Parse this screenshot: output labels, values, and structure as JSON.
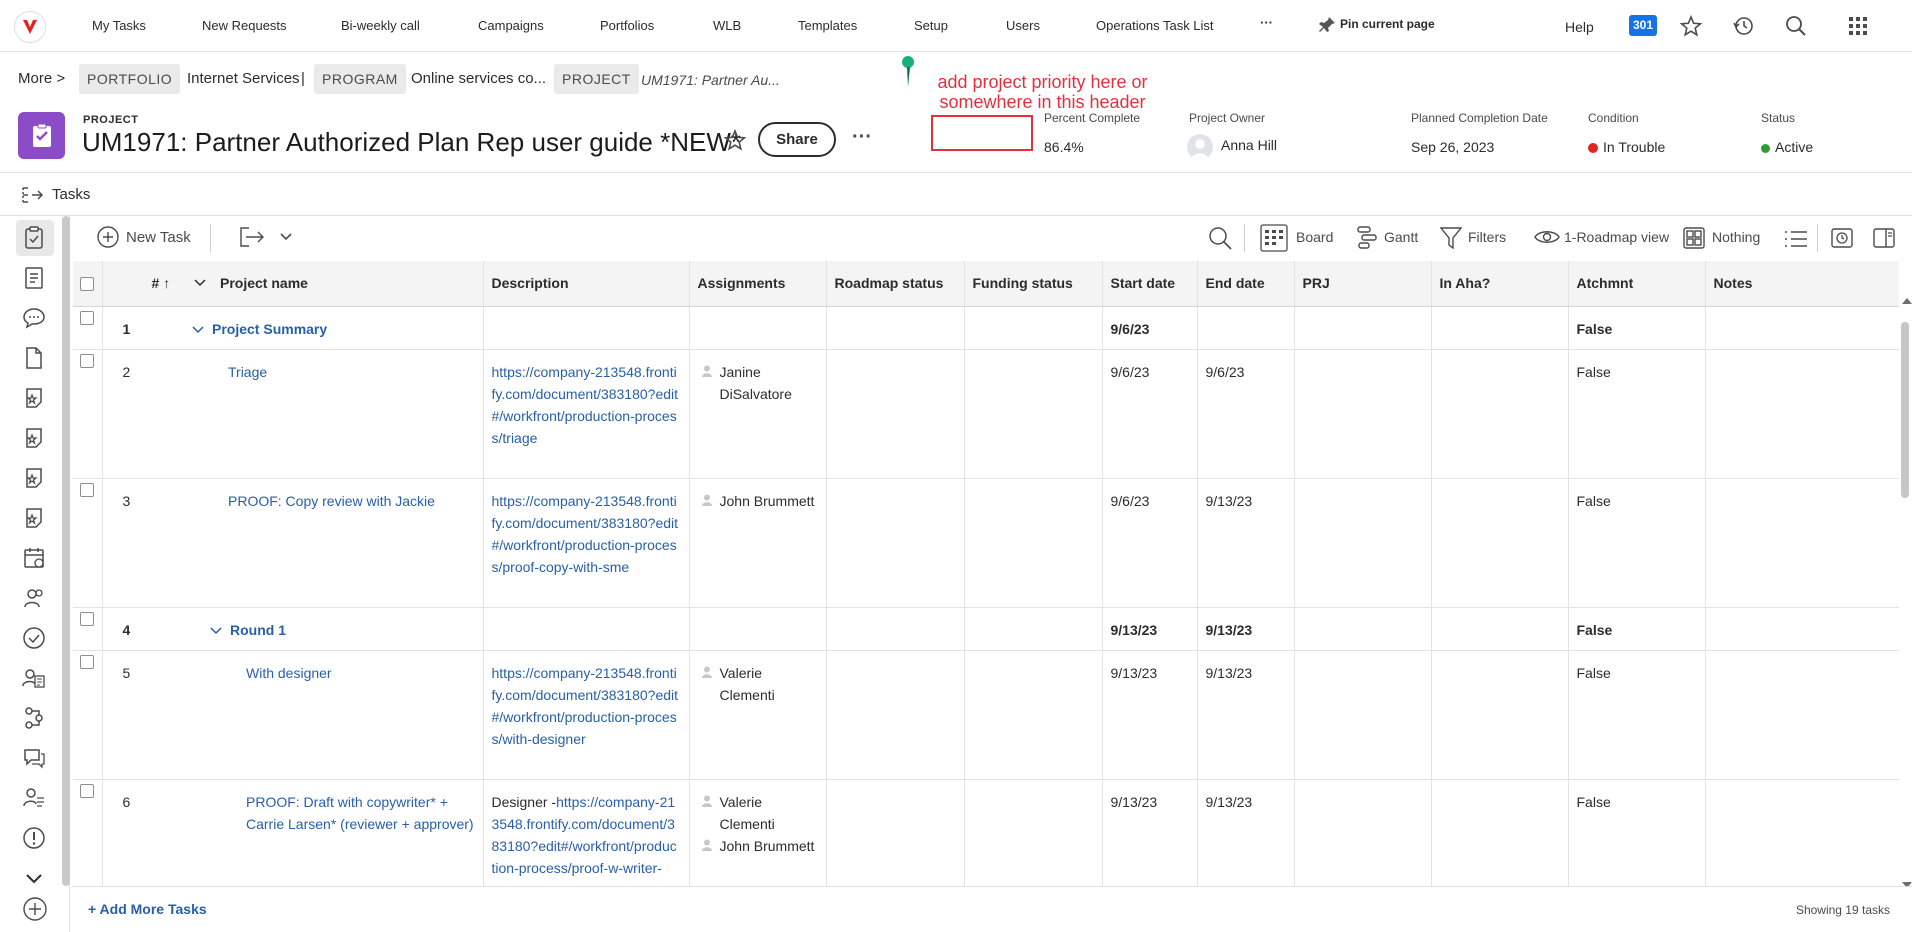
{
  "nav": {
    "items": [
      "My Tasks",
      "New Requests",
      "Bi-weekly call",
      "Campaigns",
      "Portfolios",
      "WLB",
      "Templates",
      "Setup",
      "Users",
      "Operations Task List"
    ],
    "more": "···",
    "pin": "Pin current page",
    "help": "Help",
    "badge": "301"
  },
  "breadcrumb": {
    "more": "More >",
    "portfolio_tag": "PORTFOLIO",
    "portfolio": "Internet Services",
    "sep": "|",
    "program_tag": "PROGRAM",
    "program": "Online services co...",
    "project_tag": "PROJECT",
    "project": "UM1971: Partner Au..."
  },
  "header": {
    "label": "PROJECT",
    "title": "UM1971: Partner Authorized Plan Rep user guide *NEW*",
    "share": "Share",
    "more": "···",
    "annotation": "add project priority here or somewhere in this header",
    "percent_label": "Percent Complete",
    "percent_value": "86.4%",
    "owner_label": "Project Owner",
    "owner_value": "Anna Hill",
    "planned_label": "Planned Completion Date",
    "planned_value": "Sep 26, 2023",
    "condition_label": "Condition",
    "condition_value": "In Trouble",
    "condition_color": "#e0241f",
    "status_label": "Status",
    "status_value": "Active",
    "status_color": "#2d9d38",
    "accent": "#8c4bc7"
  },
  "section": {
    "title": "Tasks"
  },
  "toolbar": {
    "new_task": "New Task",
    "board": "Board",
    "gantt": "Gantt",
    "filters": "Filters",
    "view": "1-Roadmap view",
    "grouping": "Nothing"
  },
  "columns": [
    "#",
    "Project name",
    "Description",
    "Assignments",
    "Roadmap status",
    "Funding status",
    "Start date",
    "End date",
    "PRJ",
    "In Aha?",
    "Atchmnt",
    "Notes"
  ],
  "rows": [
    {
      "num": "1",
      "name": "Project Summary",
      "group": true,
      "indent": 0,
      "desc": "",
      "desc_prefix": "",
      "assign": [],
      "start": "9/6/23",
      "end": "",
      "atch": "False",
      "bold": true
    },
    {
      "num": "2",
      "name": "Triage",
      "group": false,
      "indent": 1,
      "desc": "https://company-213548.frontify.com/document/383180?edit#/workfront/production-process/triage",
      "desc_prefix": "",
      "assign": [
        "Janine DiSalvatore"
      ],
      "start": "9/6/23",
      "end": "9/6/23",
      "atch": "False",
      "bold": false
    },
    {
      "num": "3",
      "name": "PROOF: Copy review with Jackie",
      "group": false,
      "indent": 1,
      "desc": "https://company-213548.frontify.com/document/383180?edit#/workfront/production-process/proof-copy-with-sme",
      "desc_prefix": "",
      "assign": [
        "John Brummett"
      ],
      "start": "9/6/23",
      "end": "9/13/23",
      "atch": "False",
      "bold": false
    },
    {
      "num": "4",
      "name": "Round 1",
      "group": true,
      "indent": 1,
      "desc": "",
      "desc_prefix": "",
      "assign": [],
      "start": "9/13/23",
      "end": "9/13/23",
      "atch": "False",
      "bold": true
    },
    {
      "num": "5",
      "name": "With designer",
      "group": false,
      "indent": 2,
      "desc": "https://company-213548.frontify.com/document/383180?edit#/workfront/production-process/with-designer",
      "desc_prefix": "",
      "assign": [
        "Valerie Clementi"
      ],
      "start": "9/13/23",
      "end": "9/13/23",
      "atch": "False",
      "bold": false
    },
    {
      "num": "6",
      "name": "PROOF: Draft with copywriter* + Carrie Larsen* (reviewer + approver)",
      "group": false,
      "indent": 2,
      "desc": "https://company-213548.frontify.com/document/383180?edit#/workfront/production-process/proof-w-writer-",
      "desc_prefix": "Designer -",
      "assign": [
        "Valerie Clementi",
        "John Brummett"
      ],
      "start": "9/13/23",
      "end": "9/13/23",
      "atch": "False",
      "bold": false
    }
  ],
  "footer": {
    "add_more": "+ Add More Tasks",
    "showing": "Showing 19 tasks"
  }
}
